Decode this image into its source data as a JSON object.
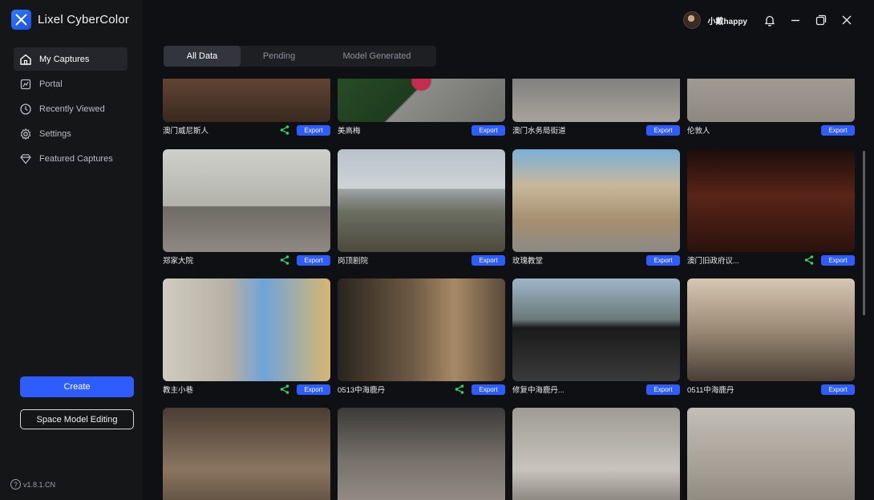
{
  "app": {
    "name": "Lixel CyberColor",
    "version": "v1.8.1.CN"
  },
  "user": {
    "name": "小戴happy"
  },
  "sidebar": {
    "items": [
      {
        "label": "My Captures",
        "icon": "home-icon",
        "active": true
      },
      {
        "label": "Portal",
        "icon": "portal-icon",
        "active": false
      },
      {
        "label": "Recently Viewed",
        "icon": "clock-icon",
        "active": false
      },
      {
        "label": "Settings",
        "icon": "gear-icon",
        "active": false
      },
      {
        "label": "Featured Captures",
        "icon": "diamond-icon",
        "active": false
      }
    ],
    "create_label": "Create",
    "space_model_label": "Space Model Editing"
  },
  "tabs": [
    {
      "label": "All Data",
      "active": true
    },
    {
      "label": "Pending",
      "active": false
    },
    {
      "label": "Model Generated",
      "active": false
    }
  ],
  "export_label": "Export",
  "captures": [
    {
      "title": "澳门威尼斯人",
      "shared": true
    },
    {
      "title": "美高梅",
      "shared": false
    },
    {
      "title": "澳门水务局街道",
      "shared": false
    },
    {
      "title": "伦敦人",
      "shared": false
    },
    {
      "title": "郑家大院",
      "shared": true
    },
    {
      "title": "岗顶剧院",
      "shared": false
    },
    {
      "title": "玫瑰教堂",
      "shared": false
    },
    {
      "title": "澳门旧政府议...",
      "shared": true
    },
    {
      "title": "教主小巷",
      "shared": true
    },
    {
      "title": "0513中海鹿丹",
      "shared": true
    },
    {
      "title": "修复中海鹿丹...",
      "shared": false
    },
    {
      "title": "0511中海鹿丹",
      "shared": false
    },
    {
      "title": "",
      "shared": false
    },
    {
      "title": "",
      "shared": false
    },
    {
      "title": "",
      "shared": false
    },
    {
      "title": "",
      "shared": false
    }
  ],
  "colors": {
    "accent": "#2d5cff",
    "share": "#3ccf6a",
    "sidebar_bg": "#151618",
    "main_bg": "#0f1013"
  }
}
